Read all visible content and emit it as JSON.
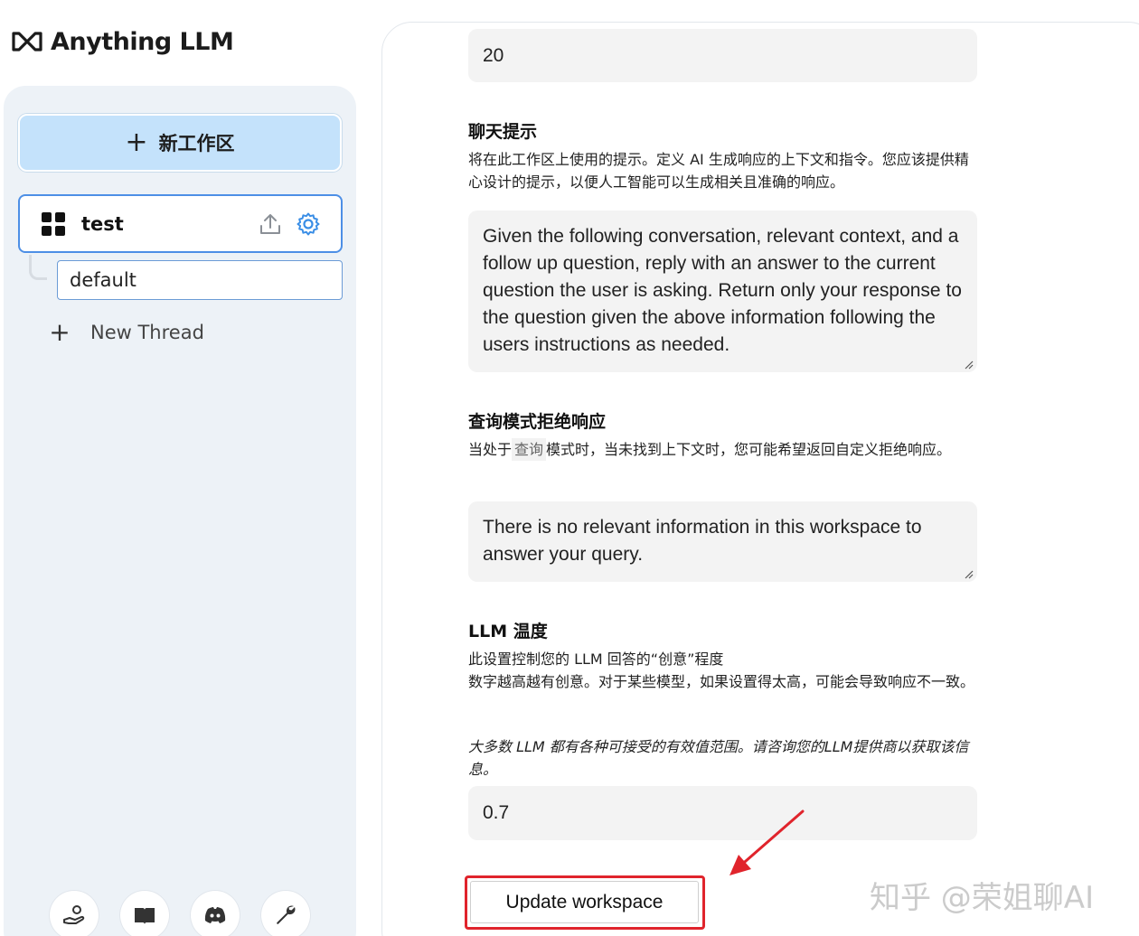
{
  "app": {
    "title": "Anything LLM"
  },
  "sidebar": {
    "new_workspace_label": "新工作区",
    "workspace": {
      "name": "test"
    },
    "thread": {
      "name": "default"
    },
    "new_thread_label": "New Thread",
    "footer_icons": [
      "community-hub-icon",
      "docs-book-icon",
      "discord-icon",
      "wrench-icon"
    ]
  },
  "settings": {
    "top_field_value": "20",
    "chat_prompt": {
      "title": "聊天提示",
      "description": "将在此工作区上使用的提示。定义 AI 生成响应的上下文和指令。您应该提供精心设计的提示，以便人工智能可以生成相关且准确的响应。",
      "value": "Given the following conversation, relevant context, and a follow up question, reply with an answer to the current question the user is asking. Return only your response to the question given the above information following the users instructions as needed."
    },
    "query_refusal": {
      "title": "查询模式拒绝响应",
      "description_pre": "当处于",
      "description_code": "查询",
      "description_post": "模式时，当未找到上下文时，您可能希望返回自定义拒绝响应。",
      "value": "There is no relevant information in this workspace to answer your query."
    },
    "llm_temperature": {
      "title": "LLM 温度",
      "description_line1": "此设置控制您的 LLM 回答的“创意”程度",
      "description_line2": "数字越高越有创意。对于某些模型，如果设置得太高，可能会导致响应不一致。",
      "note": "大多数 LLM 都有各种可接受的有效值范围。请咨询您的LLM提供商以获取该信息。",
      "value": "0.7"
    },
    "update_button_label": "Update workspace"
  },
  "watermark": "知乎 @荣姐聊AI",
  "colors": {
    "accent_blue": "#4d8fe6",
    "new_workspace_bg": "#c4e2fb",
    "highlight_red": "#e0242c",
    "sidebar_bg": "#edf2f7"
  }
}
